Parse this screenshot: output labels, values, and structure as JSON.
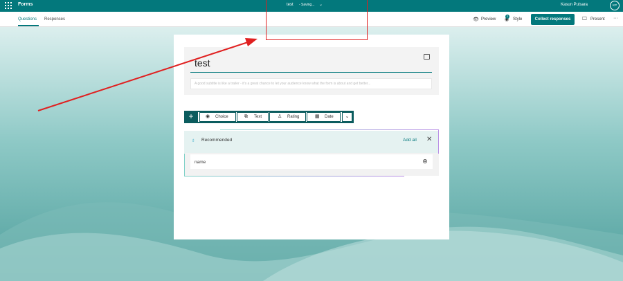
{
  "topbar": {
    "app_name": "Forms",
    "doc_title": "test",
    "doc_status": "- Saving...",
    "user_name": "Kasun Pulsara",
    "avatar_initials": "KP",
    "icons": [
      "waffle-icon",
      "chevron-down-icon"
    ]
  },
  "nav": {
    "tabs": [
      {
        "label": "Questions",
        "active": true
      },
      {
        "label": "Responses",
        "active": false
      }
    ]
  },
  "commands": {
    "preview": "Preview",
    "style": "Style",
    "style_badge": "2",
    "collect": "Collect responses",
    "present": "Present",
    "more": "···"
  },
  "form": {
    "title": "test",
    "subtitle_placeholder": "A good subtitle is like a trailer - it's a great chance to let your audience know what the form is about and get better..."
  },
  "add_toolbar": {
    "add": "+",
    "buttons": [
      {
        "label": "Choice",
        "icon": "radio-icon"
      },
      {
        "label": "Text",
        "icon": "text-icon"
      },
      {
        "label": "Rating",
        "icon": "rating-icon"
      },
      {
        "label": "Date",
        "icon": "calendar-icon"
      }
    ],
    "more": "⌄"
  },
  "recommended": {
    "label": "Recommended",
    "add_all": "Add all",
    "close": "✕",
    "suggestion": "name"
  },
  "colors": {
    "brand": "#03787c",
    "toolbar_border": "#0b5c5e",
    "annotation": "#e02020"
  }
}
